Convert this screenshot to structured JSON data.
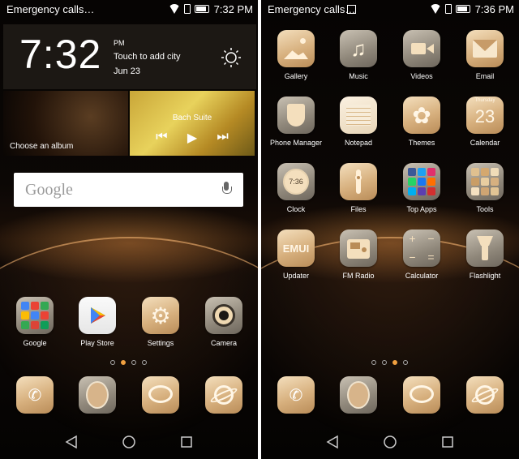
{
  "left": {
    "status": {
      "carrier": "Emergency calls…",
      "time": "7:32 PM"
    },
    "weather": {
      "time": "7:32",
      "ampm": "PM",
      "city": "Touch to add city",
      "date": "Jun 23"
    },
    "album": {
      "label": "Choose an album"
    },
    "music": {
      "track": "Bach Suite"
    },
    "search": {
      "logo": "Google"
    },
    "apps": [
      {
        "label": "Google",
        "icon": "google-folder-icon"
      },
      {
        "label": "Play Store",
        "icon": "play-store-icon"
      },
      {
        "label": "Settings",
        "icon": "gear-icon"
      },
      {
        "label": "Camera",
        "icon": "camera-icon"
      }
    ],
    "pages": {
      "count": 4,
      "active": 1
    }
  },
  "right": {
    "status": {
      "carrier": "Emergency calls…",
      "time": "7:36 PM"
    },
    "apps": [
      {
        "label": "Gallery",
        "icon": "gallery-icon"
      },
      {
        "label": "Music",
        "icon": "music-note-icon"
      },
      {
        "label": "Videos",
        "icon": "video-camera-icon"
      },
      {
        "label": "Email",
        "icon": "envelope-icon"
      },
      {
        "label": "Phone Manager",
        "icon": "shield-icon"
      },
      {
        "label": "Notepad",
        "icon": "notepad-icon"
      },
      {
        "label": "Themes",
        "icon": "flower-icon"
      },
      {
        "label": "Calendar",
        "icon": "calendar-icon",
        "weekday": "Thursday",
        "day": "23"
      },
      {
        "label": "Clock",
        "icon": "clock-icon",
        "time": "7:36"
      },
      {
        "label": "Files",
        "icon": "files-icon"
      },
      {
        "label": "Top Apps",
        "icon": "top-apps-folder-icon"
      },
      {
        "label": "Tools",
        "icon": "tools-folder-icon"
      },
      {
        "label": "Updater",
        "icon": "emui-updater-icon",
        "badge": "EMUI"
      },
      {
        "label": "FM Radio",
        "icon": "radio-icon"
      },
      {
        "label": "Calculator",
        "icon": "calculator-icon"
      },
      {
        "label": "Flashlight",
        "icon": "flashlight-icon"
      }
    ],
    "pages": {
      "count": 4,
      "active": 2
    }
  },
  "dock": [
    {
      "icon": "phone-icon"
    },
    {
      "icon": "contacts-icon"
    },
    {
      "icon": "messaging-icon"
    },
    {
      "icon": "browser-icon"
    }
  ],
  "colors": {
    "accent": "#f0a040",
    "icon_gold": "#d7b07e"
  }
}
